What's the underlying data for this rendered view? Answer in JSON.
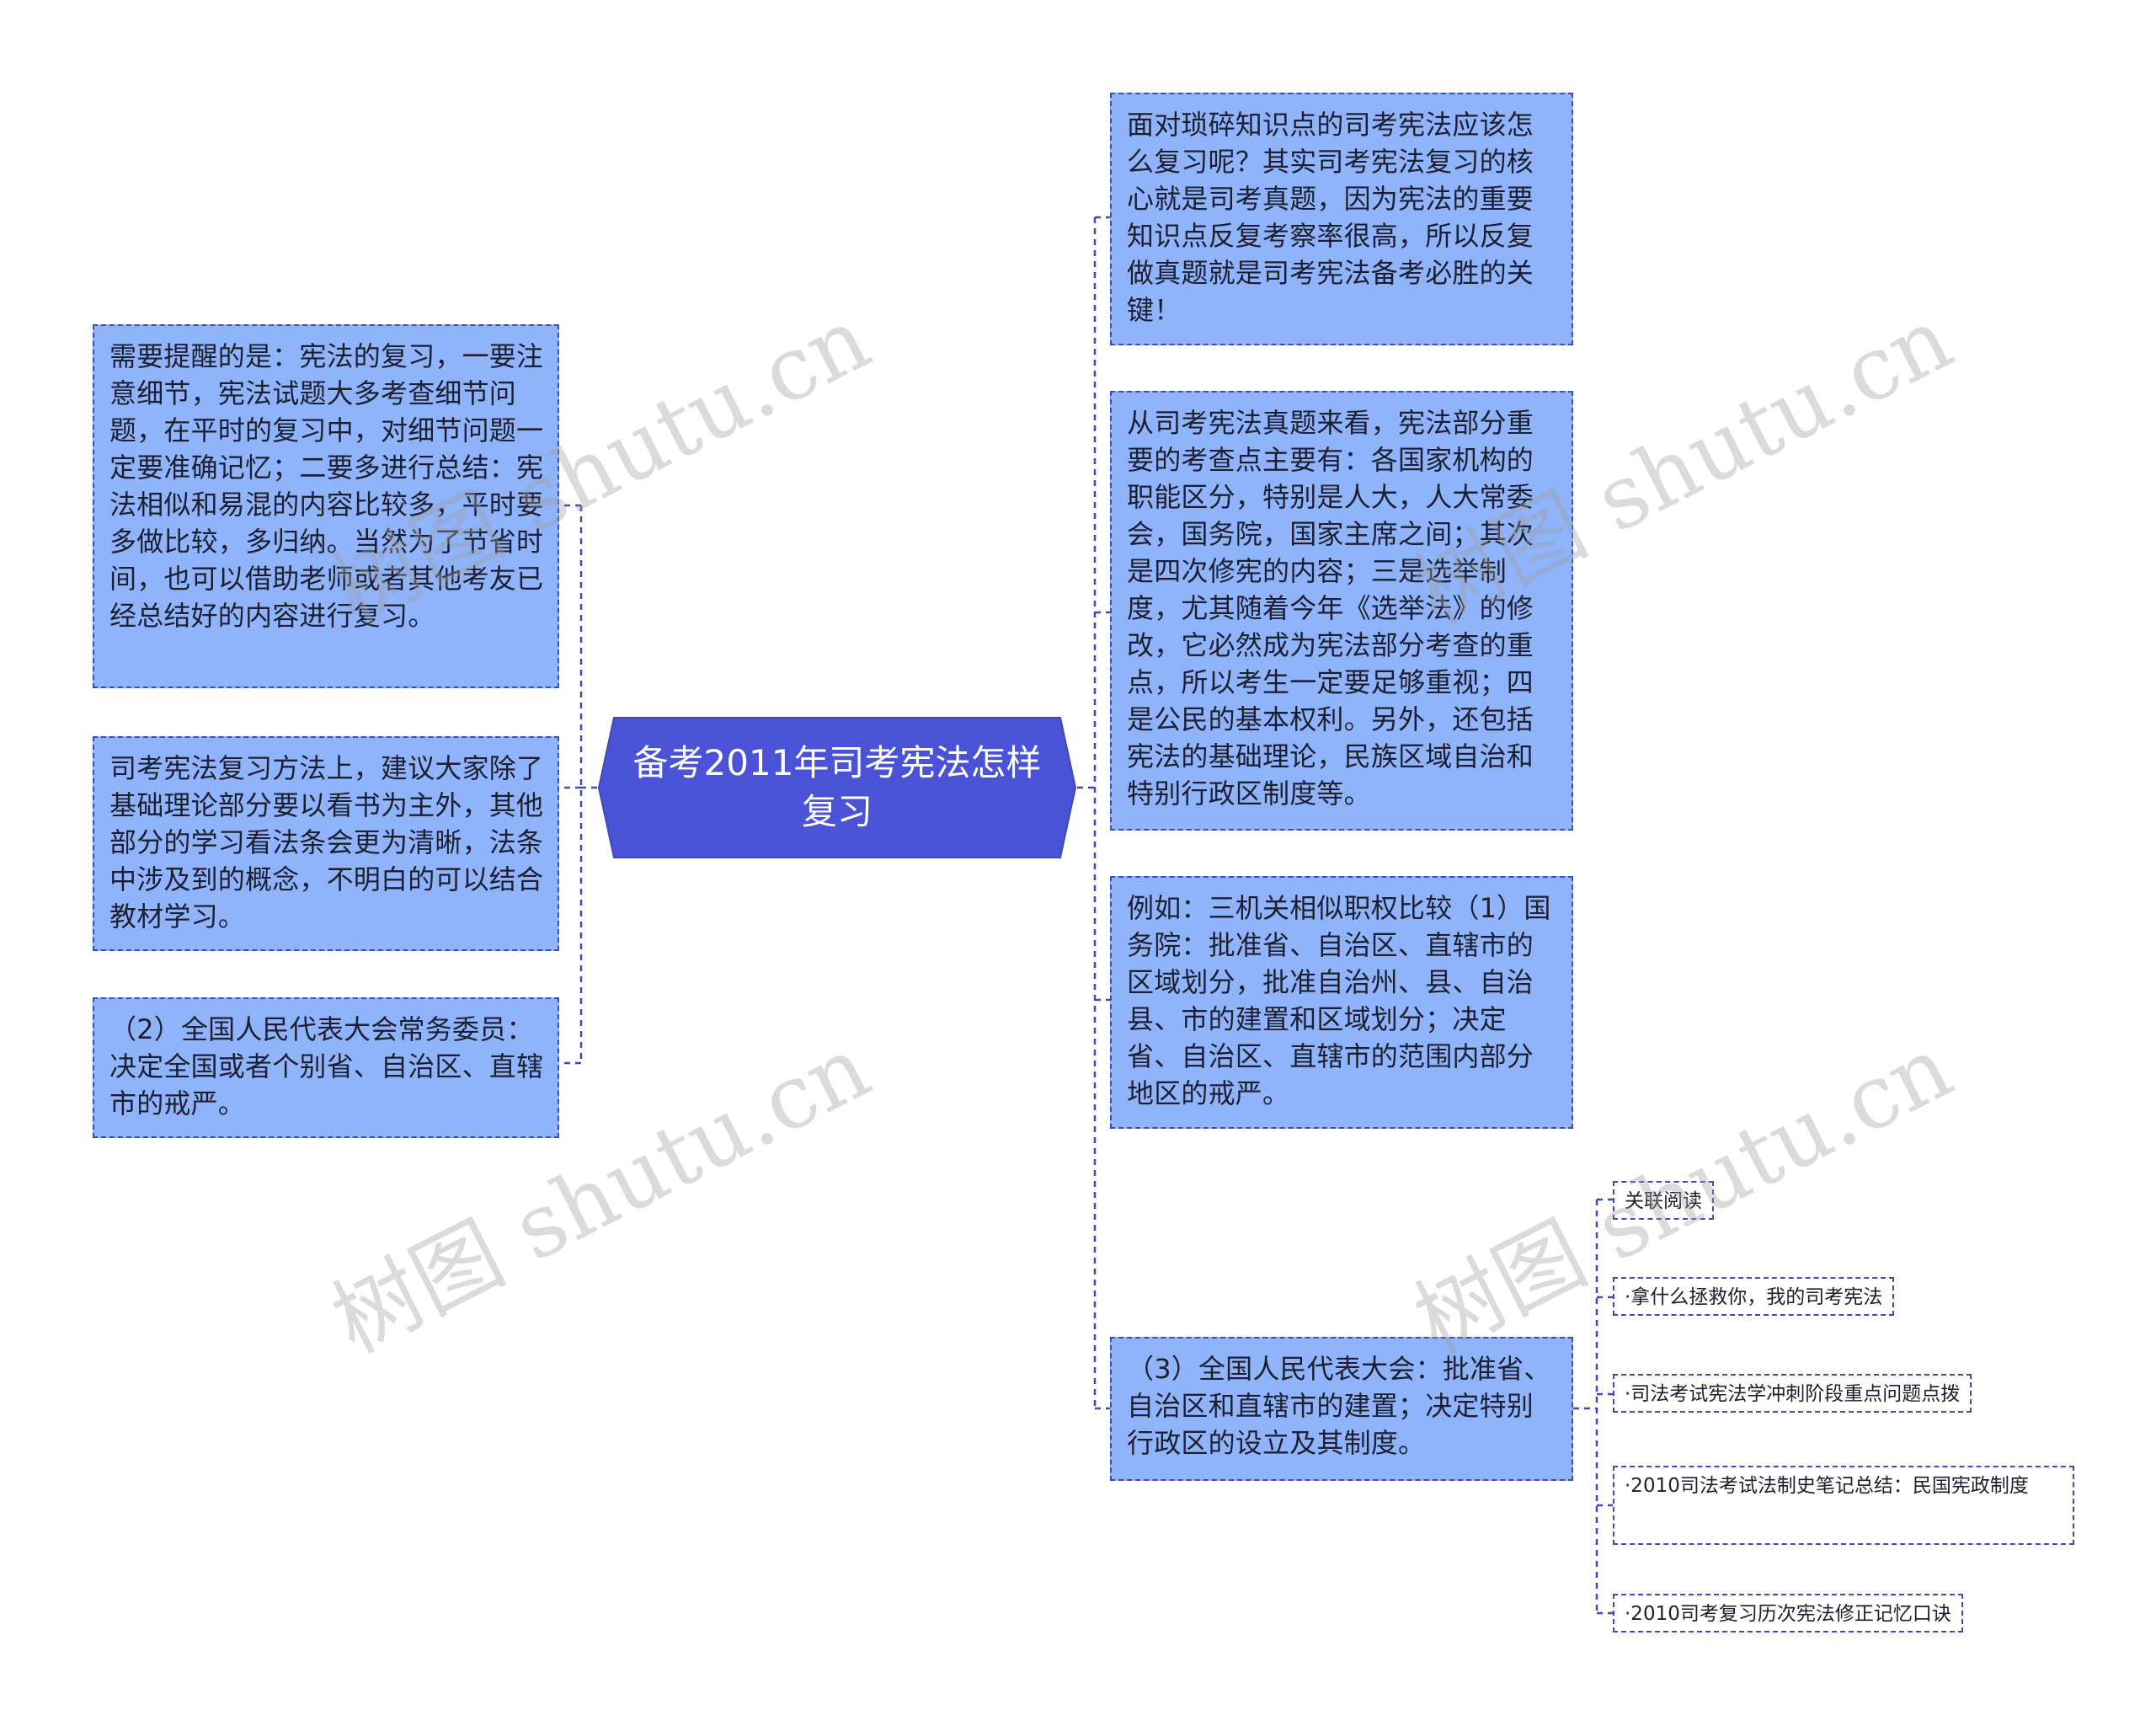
{
  "root": {
    "label": "备考2011年司考宪法怎样复习"
  },
  "left_nodes": [
    {
      "text": "需要提醒的是：宪法的复习，一要注意细节，宪法试题大多考查细节问题，在平时的复习中，对细节问题一定要准确记忆；二要多进行总结：宪法相似和易混的内容比较多，平时要多做比较，多归纳。当然为了节省时间，也可以借助老师或者其他考友已经总结好的内容进行复习。"
    },
    {
      "text": "司考宪法复习方法上，建议大家除了基础理论部分要以看书为主外，其他部分的学习看法条会更为清晰，法条中涉及到的概念，不明白的可以结合教材学习。"
    },
    {
      "text": "（2）全国人民代表大会常务委员：决定全国或者个别省、自治区、直辖市的戒严。"
    }
  ],
  "right_nodes": [
    {
      "text": "面对琐碎知识点的司考宪法应该怎么复习呢？其实司考宪法复习的核心就是司考真题，因为宪法的重要知识点反复考察率很高，所以反复做真题就是司考宪法备考必胜的关键！"
    },
    {
      "text": "从司考宪法真题来看，宪法部分重要的考查点主要有：各国家机构的职能区分，特别是人大，人大常委会，国务院，国家主席之间；其次是四次修宪的内容；三是选举制度，尤其随着今年《选举法》的修改，它必然成为宪法部分考查的重点，所以考生一定要足够重视；四是公民的基本权利。另外，还包括宪法的基础理论，民族区域自治和特别行政区制度等。"
    },
    {
      "text": "例如：三机关相似职权比较（1）国务院：批准省、自治区、直辖市的区域划分，批准自治州、县、自治县、市的建置和区域划分；决定省、自治区、直辖市的范围内部分地区的戒严。"
    },
    {
      "text": "（3）全国人民代表大会：批准省、自治区和直辖市的建置；决定特别行政区的设立及其制度。"
    }
  ],
  "related": [
    {
      "text": "关联阅读"
    },
    {
      "text": "·拿什么拯救你，我的司考宪法"
    },
    {
      "text": "·司法考试宪法学冲刺阶段重点问题点拨"
    },
    {
      "text": "·2010司法考试法制史笔记总结：民国宪政制度"
    },
    {
      "text": "·2010司考复习历次宪法修正记忆口诀"
    }
  ],
  "watermarks": [
    "树图 shutu.cn",
    "树图 shutu.cn",
    "树图 shutu.cn",
    "树图 shutu.cn"
  ],
  "colors": {
    "root_fill": "#4a52d6",
    "node_fill": "#8fb4fb",
    "node_border": "#3d4ab8",
    "connector": "#3d4ab8"
  }
}
